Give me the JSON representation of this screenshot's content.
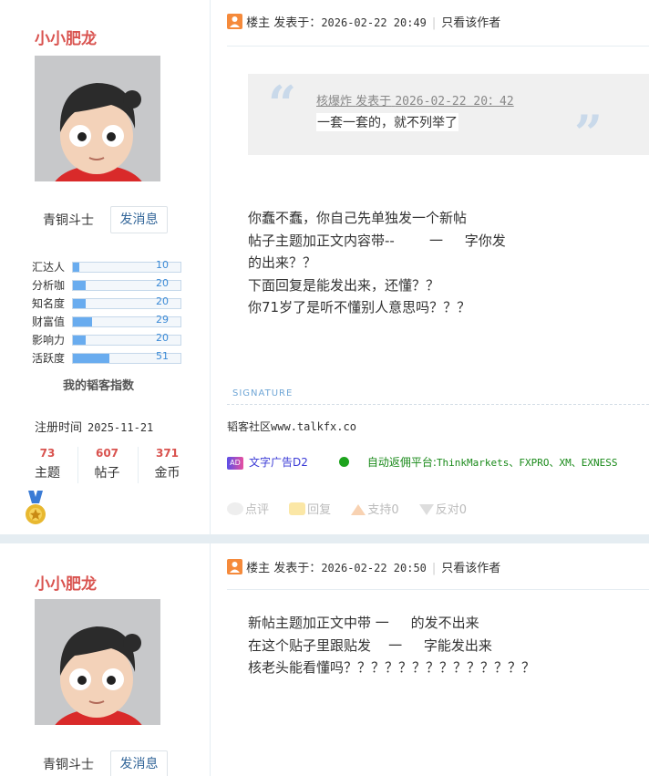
{
  "posts": [
    {
      "author": {
        "name": "小小肥龙",
        "rank": "青铜斗士",
        "message_button": "发消息",
        "stats": [
          {
            "label": "汇达人",
            "value": "10",
            "level": 0.06
          },
          {
            "label": "分析咖",
            "value": "20",
            "level": 0.12
          },
          {
            "label": "知名度",
            "value": "20",
            "level": 0.12
          },
          {
            "label": "财富值",
            "value": "29",
            "level": 0.18
          },
          {
            "label": "影响力",
            "value": "20",
            "level": 0.12
          },
          {
            "label": "活跃度",
            "value": "51",
            "level": 0.34
          }
        ],
        "index_title": "我的韬客指数",
        "register_label": "注册时间",
        "register_date": "2025-11-21",
        "counts": [
          {
            "value": "73",
            "label": "主题"
          },
          {
            "value": "607",
            "label": "帖子"
          },
          {
            "value": "371",
            "label": "金币"
          }
        ],
        "medal_icon": "medal-icon"
      },
      "header": {
        "role": "楼主",
        "posted_prefix": "发表于：",
        "time": "2026-02-22 20:49",
        "only_author": "只看该作者"
      },
      "quote": {
        "author": "核爆炸",
        "posted": "发表于",
        "time": "2026-02-22 20：42",
        "text": "一套一套的，就不列举了"
      },
      "body": "你蠢不蠢，你自己先单独发一个新帖\n帖子主题加正文内容带--        一     字你发\n的出来？？\n下面回复是能发出来，还懂？？\n你71岁了是听不懂别人意思吗？？？",
      "signature": {
        "label": "SIGNATURE",
        "text_prefix": "韬客社区",
        "text_url": "www.talkfx.co"
      },
      "ads": {
        "badge": "AD",
        "ad1": "文字广告D2",
        "ad2_prefix": "自动返佣平台:",
        "ad2_list": "ThinkMarkets、FXPRO、XM、EXNESS"
      },
      "actions": {
        "comment": "点评",
        "reply": "回复",
        "support": "支持0",
        "oppose": "反对0"
      }
    },
    {
      "author": {
        "name": "小小肥龙",
        "rank": "青铜斗士",
        "message_button": "发消息"
      },
      "header": {
        "role": "楼主",
        "posted_prefix": "发表于：",
        "time": "2026-02-22 20:50",
        "only_author": "只看该作者"
      },
      "body": "新帖主题加正文中带 一     的发不出来\n在这个贴子里跟贴发    一     字能发出来\n核老头能看懂吗？？？？？？？？？？？？？？"
    }
  ]
}
